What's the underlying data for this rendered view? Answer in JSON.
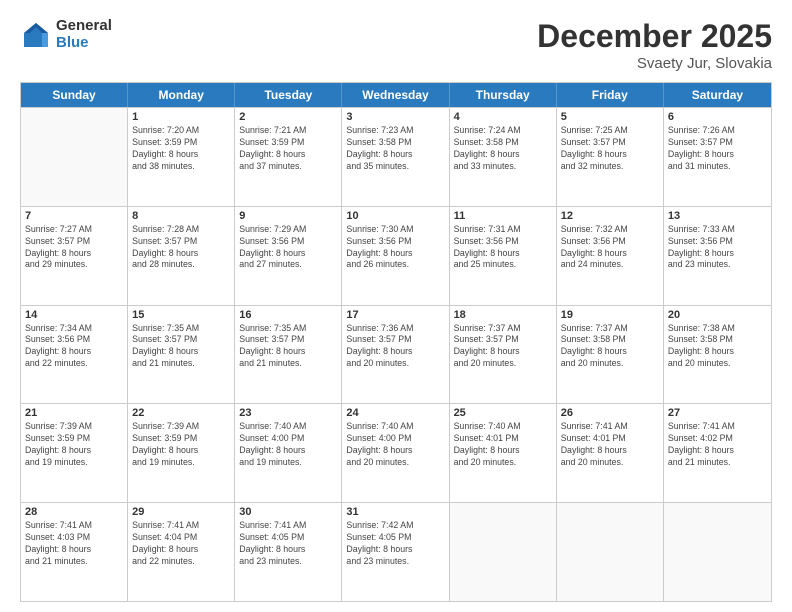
{
  "logo": {
    "general": "General",
    "blue": "Blue"
  },
  "header": {
    "month": "December 2025",
    "location": "Svaety Jur, Slovakia"
  },
  "weekdays": [
    "Sunday",
    "Monday",
    "Tuesday",
    "Wednesday",
    "Thursday",
    "Friday",
    "Saturday"
  ],
  "rows": [
    [
      {
        "day": "",
        "info": ""
      },
      {
        "day": "1",
        "info": "Sunrise: 7:20 AM\nSunset: 3:59 PM\nDaylight: 8 hours\nand 38 minutes."
      },
      {
        "day": "2",
        "info": "Sunrise: 7:21 AM\nSunset: 3:59 PM\nDaylight: 8 hours\nand 37 minutes."
      },
      {
        "day": "3",
        "info": "Sunrise: 7:23 AM\nSunset: 3:58 PM\nDaylight: 8 hours\nand 35 minutes."
      },
      {
        "day": "4",
        "info": "Sunrise: 7:24 AM\nSunset: 3:58 PM\nDaylight: 8 hours\nand 33 minutes."
      },
      {
        "day": "5",
        "info": "Sunrise: 7:25 AM\nSunset: 3:57 PM\nDaylight: 8 hours\nand 32 minutes."
      },
      {
        "day": "6",
        "info": "Sunrise: 7:26 AM\nSunset: 3:57 PM\nDaylight: 8 hours\nand 31 minutes."
      }
    ],
    [
      {
        "day": "7",
        "info": "Sunrise: 7:27 AM\nSunset: 3:57 PM\nDaylight: 8 hours\nand 29 minutes."
      },
      {
        "day": "8",
        "info": "Sunrise: 7:28 AM\nSunset: 3:57 PM\nDaylight: 8 hours\nand 28 minutes."
      },
      {
        "day": "9",
        "info": "Sunrise: 7:29 AM\nSunset: 3:56 PM\nDaylight: 8 hours\nand 27 minutes."
      },
      {
        "day": "10",
        "info": "Sunrise: 7:30 AM\nSunset: 3:56 PM\nDaylight: 8 hours\nand 26 minutes."
      },
      {
        "day": "11",
        "info": "Sunrise: 7:31 AM\nSunset: 3:56 PM\nDaylight: 8 hours\nand 25 minutes."
      },
      {
        "day": "12",
        "info": "Sunrise: 7:32 AM\nSunset: 3:56 PM\nDaylight: 8 hours\nand 24 minutes."
      },
      {
        "day": "13",
        "info": "Sunrise: 7:33 AM\nSunset: 3:56 PM\nDaylight: 8 hours\nand 23 minutes."
      }
    ],
    [
      {
        "day": "14",
        "info": "Sunrise: 7:34 AM\nSunset: 3:56 PM\nDaylight: 8 hours\nand 22 minutes."
      },
      {
        "day": "15",
        "info": "Sunrise: 7:35 AM\nSunset: 3:57 PM\nDaylight: 8 hours\nand 21 minutes."
      },
      {
        "day": "16",
        "info": "Sunrise: 7:35 AM\nSunset: 3:57 PM\nDaylight: 8 hours\nand 21 minutes."
      },
      {
        "day": "17",
        "info": "Sunrise: 7:36 AM\nSunset: 3:57 PM\nDaylight: 8 hours\nand 20 minutes."
      },
      {
        "day": "18",
        "info": "Sunrise: 7:37 AM\nSunset: 3:57 PM\nDaylight: 8 hours\nand 20 minutes."
      },
      {
        "day": "19",
        "info": "Sunrise: 7:37 AM\nSunset: 3:58 PM\nDaylight: 8 hours\nand 20 minutes."
      },
      {
        "day": "20",
        "info": "Sunrise: 7:38 AM\nSunset: 3:58 PM\nDaylight: 8 hours\nand 20 minutes."
      }
    ],
    [
      {
        "day": "21",
        "info": "Sunrise: 7:39 AM\nSunset: 3:59 PM\nDaylight: 8 hours\nand 19 minutes."
      },
      {
        "day": "22",
        "info": "Sunrise: 7:39 AM\nSunset: 3:59 PM\nDaylight: 8 hours\nand 19 minutes."
      },
      {
        "day": "23",
        "info": "Sunrise: 7:40 AM\nSunset: 4:00 PM\nDaylight: 8 hours\nand 19 minutes."
      },
      {
        "day": "24",
        "info": "Sunrise: 7:40 AM\nSunset: 4:00 PM\nDaylight: 8 hours\nand 20 minutes."
      },
      {
        "day": "25",
        "info": "Sunrise: 7:40 AM\nSunset: 4:01 PM\nDaylight: 8 hours\nand 20 minutes."
      },
      {
        "day": "26",
        "info": "Sunrise: 7:41 AM\nSunset: 4:01 PM\nDaylight: 8 hours\nand 20 minutes."
      },
      {
        "day": "27",
        "info": "Sunrise: 7:41 AM\nSunset: 4:02 PM\nDaylight: 8 hours\nand 21 minutes."
      }
    ],
    [
      {
        "day": "28",
        "info": "Sunrise: 7:41 AM\nSunset: 4:03 PM\nDaylight: 8 hours\nand 21 minutes."
      },
      {
        "day": "29",
        "info": "Sunrise: 7:41 AM\nSunset: 4:04 PM\nDaylight: 8 hours\nand 22 minutes."
      },
      {
        "day": "30",
        "info": "Sunrise: 7:41 AM\nSunset: 4:05 PM\nDaylight: 8 hours\nand 23 minutes."
      },
      {
        "day": "31",
        "info": "Sunrise: 7:42 AM\nSunset: 4:05 PM\nDaylight: 8 hours\nand 23 minutes."
      },
      {
        "day": "",
        "info": ""
      },
      {
        "day": "",
        "info": ""
      },
      {
        "day": "",
        "info": ""
      }
    ]
  ]
}
